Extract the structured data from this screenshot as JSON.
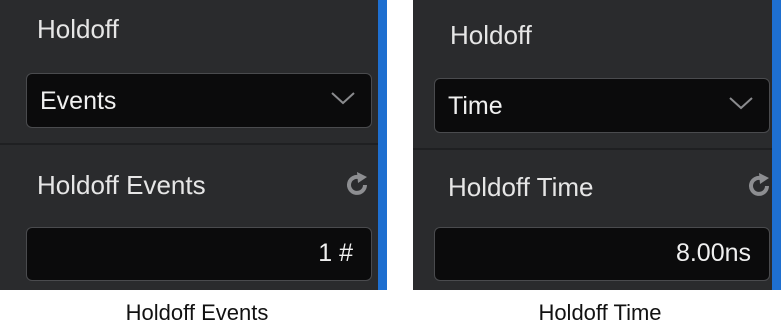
{
  "holdoff_events_panel": {
    "holdoff_label": "Holdoff",
    "mode_selected": "Events",
    "events_label": "Holdoff Events",
    "events_value": "1 #",
    "caption": "Holdoff Events"
  },
  "holdoff_time_panel": {
    "holdoff_label": "Holdoff",
    "mode_selected": "Time",
    "time_label": "Holdoff Time",
    "time_value": "8.00ns",
    "caption": "Holdoff Time"
  },
  "icons": {
    "dropdown": "chevron-down-icon",
    "reset": "refresh-icon"
  },
  "colors": {
    "panel_bg": "#2a2b2d",
    "field_bg": "#0b0b0c",
    "accent": "#1e6fd0",
    "text": "#e6e6e6"
  }
}
